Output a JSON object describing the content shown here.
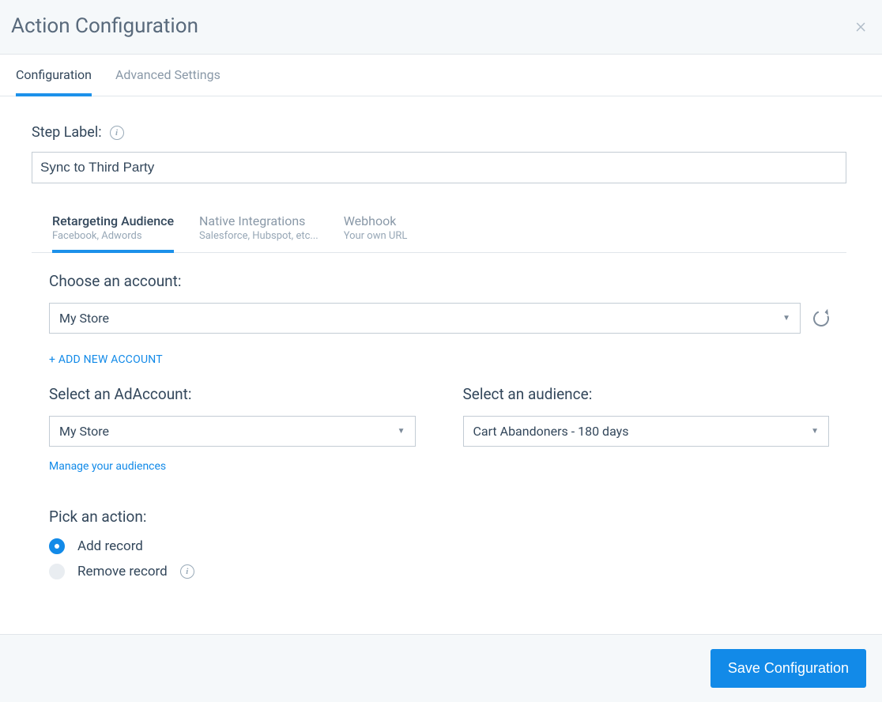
{
  "header": {
    "title": "Action Configuration"
  },
  "mainTabs": [
    {
      "label": "Configuration",
      "active": true
    },
    {
      "label": "Advanced Settings",
      "active": false
    }
  ],
  "stepLabel": {
    "label": "Step Label:",
    "value": "Sync to Third Party"
  },
  "subTabs": [
    {
      "title": "Retargeting Audience",
      "subtitle": "Facebook, Adwords",
      "active": true
    },
    {
      "title": "Native Integrations",
      "subtitle": "Salesforce, Hubspot, etc...",
      "active": false
    },
    {
      "title": "Webhook",
      "subtitle": "Your own URL",
      "active": false
    }
  ],
  "account": {
    "label": "Choose an account:",
    "value": "My Store",
    "addNew": "+ Add New Account"
  },
  "adAccount": {
    "label": "Select an AdAccount:",
    "value": "My Store",
    "manageLink": "Manage your audiences"
  },
  "audience": {
    "label": "Select an audience:",
    "value": "Cart Abandoners - 180 days"
  },
  "action": {
    "label": "Pick an action:",
    "options": [
      {
        "label": "Add record",
        "selected": true
      },
      {
        "label": "Remove record",
        "selected": false
      }
    ]
  },
  "footer": {
    "save": "Save Configuration"
  }
}
